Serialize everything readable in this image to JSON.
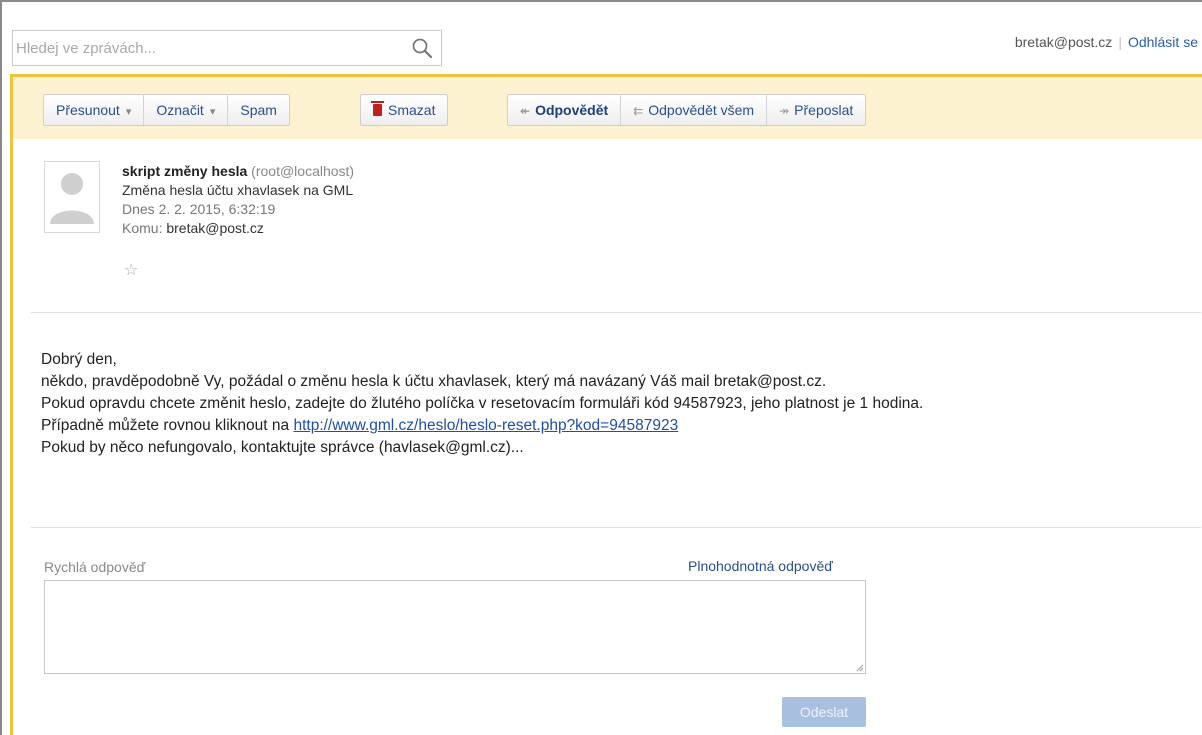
{
  "search": {
    "placeholder": "Hledej ve zprávách..."
  },
  "account": {
    "email": "bretak@post.cz",
    "logout": "Odhlásit se"
  },
  "toolbar": {
    "move": "Přesunout",
    "mark": "Označit",
    "spam": "Spam",
    "delete": "Smazat",
    "reply": "Odpovědět",
    "reply_all": "Odpovědět všem",
    "forward": "Přeposlat"
  },
  "message": {
    "sender_name": "skript změny hesla",
    "sender_address": "(root@localhost)",
    "subject": "Změna hesla účtu xhavlasek na GML",
    "date": "Dnes 2. 2. 2015, 6:32:19",
    "to_label": "Komu:",
    "to_value": "bretak@post.cz",
    "star_icon": "star-outline-icon",
    "body": {
      "greeting": "Dobrý den,",
      "line1": "někdo, pravděpodobně Vy, požádal o změnu hesla k účtu xhavlasek, který má navázaný Váš mail bretak@post.cz.",
      "line2": "Pokud opravdu chcete změnit heslo, zadejte do žlutého políčka v resetovacím formuláři kód 94587923, jeho platnost je 1 hodina.",
      "line3_prefix": "Případně můžete rovnou kliknout na ",
      "link": "http://www.gml.cz/heslo/heslo-reset.php?kod=94587923",
      "line4": "Pokud by něco nefungovalo, kontaktujte správce (havlasek@gml.cz)..."
    }
  },
  "quick_reply": {
    "label": "Rychlá odpověď",
    "full_reply": "Plnohodnotná odpověď",
    "send": "Odeslat"
  },
  "colors": {
    "accent_yellow": "#f0c43a",
    "toolbar_bg": "#fdf2cf",
    "link_blue": "#1f4fa8",
    "delete_red": "#c0201c"
  }
}
